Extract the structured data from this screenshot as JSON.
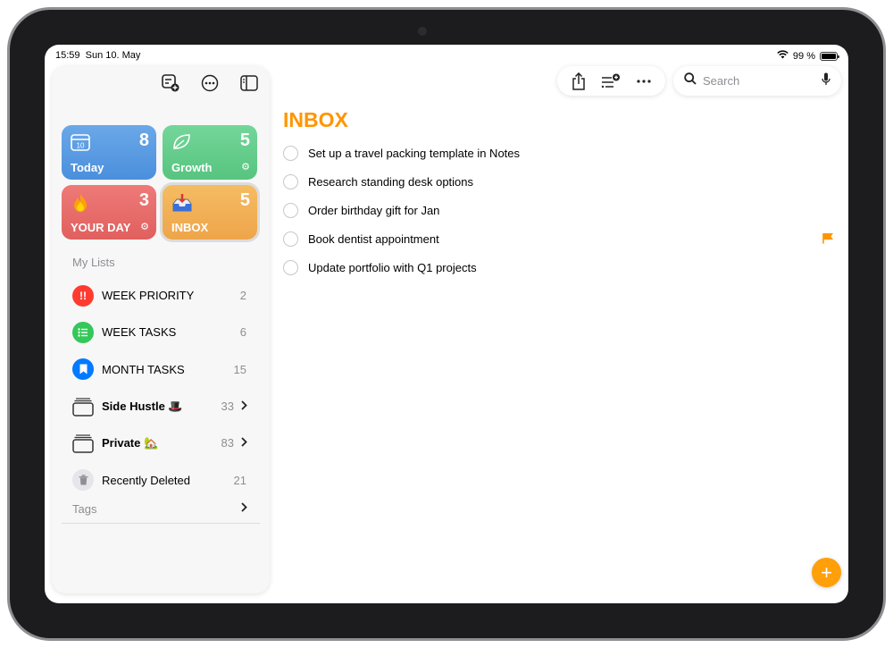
{
  "status": {
    "time": "15:59",
    "date": "Sun 10. May",
    "battery": "99 %",
    "battery_level": 0.99
  },
  "tiles": {
    "today": {
      "label": "Today",
      "count": "8",
      "icon": "calendar-icon"
    },
    "growth": {
      "label": "Growth",
      "count": "5",
      "icon": "leaf-icon"
    },
    "yourday": {
      "label": "YOUR DAY",
      "count": "3",
      "icon": "fire-icon"
    },
    "inbox": {
      "label": "INBOX",
      "count": "5",
      "icon": "inbox-tray-icon"
    }
  },
  "sidebar": {
    "section_title": "My Lists",
    "lists": [
      {
        "label": "WEEK PRIORITY",
        "count": "2",
        "color": "#ff3b30",
        "icon": "exclamation-icon"
      },
      {
        "label": "WEEK TASKS",
        "count": "6",
        "color": "#34c759",
        "icon": "list-bullet-icon"
      },
      {
        "label": "MONTH TASKS",
        "count": "15",
        "color": "#007aff",
        "icon": "bookmark-icon"
      },
      {
        "label": "Side Hustle 🎩",
        "count": "33",
        "icon": "folder-stack-icon"
      },
      {
        "label": "Private 🏡",
        "count": "83",
        "icon": "folder-stack-icon"
      },
      {
        "label": "Recently Deleted",
        "count": "21",
        "icon": "trash-icon"
      }
    ],
    "tags_label": "Tags"
  },
  "search": {
    "placeholder": "Search"
  },
  "main": {
    "title": "INBOX",
    "accent": "#ff9500",
    "tasks": [
      {
        "text": "Set up a travel packing template in Notes",
        "flagged": false
      },
      {
        "text": "Research standing desk options",
        "flagged": false
      },
      {
        "text": "Order birthday gift for Jan",
        "flagged": false
      },
      {
        "text": "Book dentist appointment",
        "flagged": true
      },
      {
        "text": "Update portfolio with Q1 projects",
        "flagged": false
      }
    ]
  }
}
